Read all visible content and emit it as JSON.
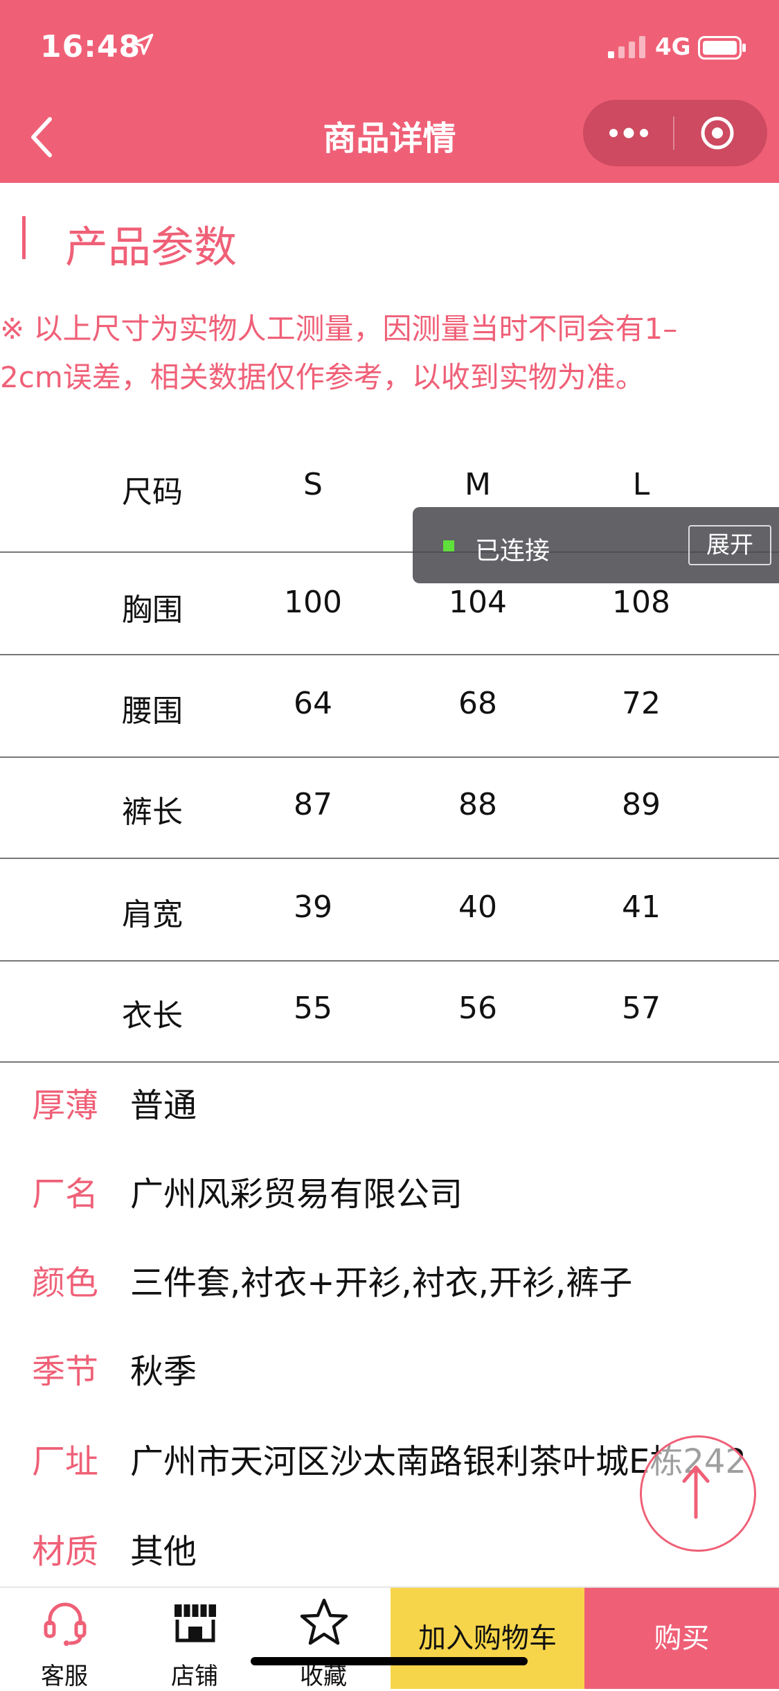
{
  "status": {
    "time": "16:48",
    "network": "4G"
  },
  "header": {
    "title": "商品详情"
  },
  "section": {
    "title": "产品参数",
    "note_line1": "※ 以上尺寸为实物人工测量，因测量当时不同会有1–",
    "note_line2": "2cm误差，相关数据仅作参考，以收到实物为准。"
  },
  "size_table": {
    "headers": [
      "尺码",
      "S",
      "M",
      "L"
    ],
    "rows": [
      [
        "胸围",
        "100",
        "104",
        "108"
      ],
      [
        "腰围",
        "64",
        "68",
        "72"
      ],
      [
        "裤长",
        "87",
        "88",
        "89"
      ],
      [
        "肩宽",
        "39",
        "40",
        "41"
      ],
      [
        "衣长",
        "55",
        "56",
        "57"
      ]
    ]
  },
  "toast": {
    "text": "已连接",
    "button": "展开"
  },
  "attributes": [
    {
      "key": "厚薄",
      "value": "普通"
    },
    {
      "key": "厂名",
      "value": "广州风彩贸易有限公司"
    },
    {
      "key": "颜色",
      "value": "三件套,衬衣+开衫,衬衣,开衫,裤子"
    },
    {
      "key": "季节",
      "value": "秋季"
    },
    {
      "key": "厂址",
      "value": "广州市天河区沙太南路银利茶叶城E栋242"
    },
    {
      "key": "材质",
      "value": "其他"
    }
  ],
  "bottom_bar": {
    "service": "客服",
    "shop": "店铺",
    "favorite": "收藏",
    "add_to_cart": "加入购物车",
    "buy": "购买"
  },
  "colors": {
    "accent": "#ef6077",
    "cart": "#f7d54a"
  }
}
